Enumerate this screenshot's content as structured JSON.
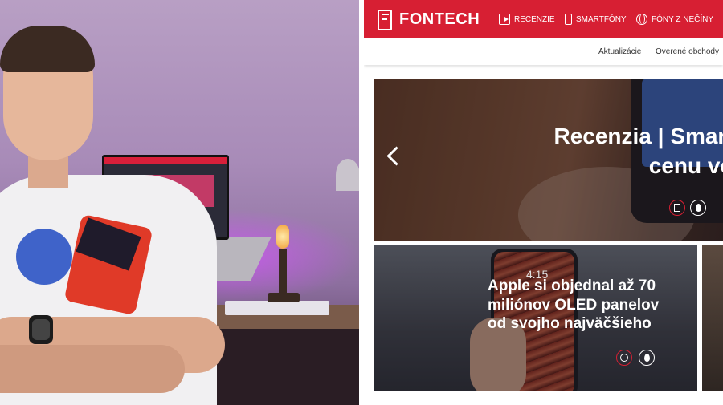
{
  "site": {
    "brand": "FONTECH",
    "accent_color": "#d71f33",
    "nav": [
      {
        "label": "RECENZIE",
        "icon": "review-icon"
      },
      {
        "label": "SMARTFÓNY",
        "icon": "smartphone-icon"
      },
      {
        "label": "FÓNY Z NEČÍNY",
        "icon": "globe-icon"
      }
    ],
    "subnav": [
      "Aktualizácie",
      "Overené obchody"
    ],
    "hero": {
      "title_line1": "Recenzia | Smartwatch",
      "title_line2": "cenu večere v",
      "badges": [
        "review-icon",
        "flame-icon"
      ]
    },
    "card1": {
      "screen_time": "4:15",
      "title_line1": "Apple si objednal až 70",
      "title_line2": "miliónov OLED panelov",
      "title_line3": "od svojho najväčšieho",
      "badges": [
        "globe-icon",
        "flame-icon"
      ]
    }
  }
}
